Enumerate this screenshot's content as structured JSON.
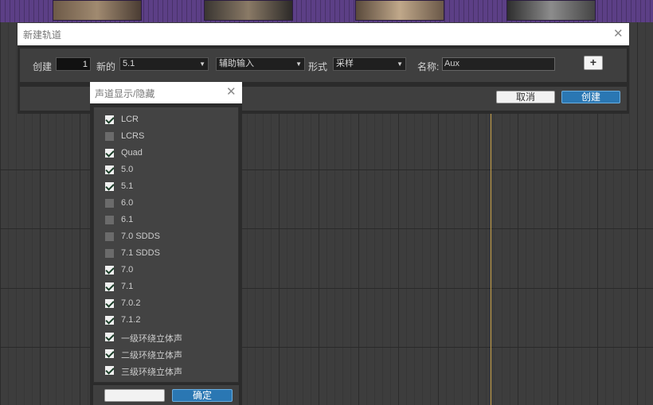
{
  "main_dialog": {
    "title": "新建轨道",
    "create_label": "创建",
    "count": "1",
    "new_label": "新的",
    "channel_format": "5.1",
    "track_type": "辅助输入",
    "form_label": "形式",
    "form_value": "采样",
    "name_label": "名称:",
    "name_value": "Aux",
    "add_label": "+",
    "cancel_label": "取消",
    "create_button_label": "创建"
  },
  "channel_popup": {
    "title": "声道显示/隐藏",
    "items": [
      {
        "label": "LCR",
        "checked": true
      },
      {
        "label": "LCRS",
        "checked": false
      },
      {
        "label": "Quad",
        "checked": true
      },
      {
        "label": "5.0",
        "checked": true
      },
      {
        "label": "5.1",
        "checked": true
      },
      {
        "label": "6.0",
        "checked": false
      },
      {
        "label": "6.1",
        "checked": false
      },
      {
        "label": "7.0 SDDS",
        "checked": false
      },
      {
        "label": "7.1 SDDS",
        "checked": false
      },
      {
        "label": "7.0",
        "checked": true
      },
      {
        "label": "7.1",
        "checked": true
      },
      {
        "label": "7.0.2",
        "checked": true
      },
      {
        "label": "7.1.2",
        "checked": true
      },
      {
        "label": "一级环绕立体声",
        "checked": true
      },
      {
        "label": "二级环绕立体声",
        "checked": true
      },
      {
        "label": "三级环绕立体声",
        "checked": true
      }
    ],
    "ok_label": "确定"
  },
  "colors": {
    "accent_blue": "#2a77b3",
    "region_purple": "#5c3f86",
    "playhead": "#c9a24a"
  }
}
